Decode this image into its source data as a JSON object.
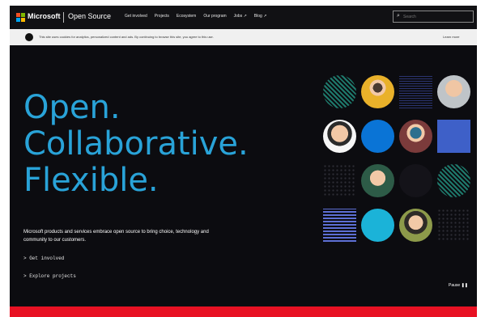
{
  "header": {
    "brand": "Microsoft",
    "site_title": "Open Source",
    "nav": [
      "Get involved",
      "Projects",
      "Ecosystem",
      "Our program",
      "Jobs ↗",
      "Blog ↗"
    ],
    "search_placeholder": "Search"
  },
  "cookie_banner": {
    "message": "This site uses cookies for analytics, personalized content and ads. By continuing to browse this site, you agree to this use.",
    "dismiss_label": "Learn more"
  },
  "hero": {
    "line1": "Open.",
    "line2": "Collaborative.",
    "line3": "Flexible.",
    "description": "Microsoft products and services embrace open source to bring choice, technology and community to our customers.",
    "link_get_involved": "> Get involved",
    "link_projects": "> Explore projects",
    "pause_label": "Pause ❚❚"
  },
  "colors": {
    "hero_text": "#29a3d8",
    "background": "#0c0c10",
    "footer_bar": "#e81123"
  },
  "grid_tiles": [
    {
      "name": "teal-stripe-circle",
      "shape": "circle"
    },
    {
      "name": "person-avatar",
      "shape": "circle"
    },
    {
      "name": "dark-pattern-tile",
      "shape": "square"
    },
    {
      "name": "person-avatar",
      "shape": "circle"
    },
    {
      "name": "person-avatar",
      "shape": "circle"
    },
    {
      "name": "blue-circle",
      "shape": "circle"
    },
    {
      "name": "person-avatar",
      "shape": "circle"
    },
    {
      "name": "blue-square",
      "shape": "square"
    },
    {
      "name": "dotted-tile",
      "shape": "square"
    },
    {
      "name": "person-avatar",
      "shape": "circle"
    },
    {
      "name": "dark-circle",
      "shape": "circle"
    },
    {
      "name": "teal-stripe-circle",
      "shape": "circle"
    },
    {
      "name": "blue-stripe-square",
      "shape": "square"
    },
    {
      "name": "cyan-circle",
      "shape": "circle"
    },
    {
      "name": "person-avatar",
      "shape": "circle"
    },
    {
      "name": "dotted-tile",
      "shape": "square"
    }
  ]
}
